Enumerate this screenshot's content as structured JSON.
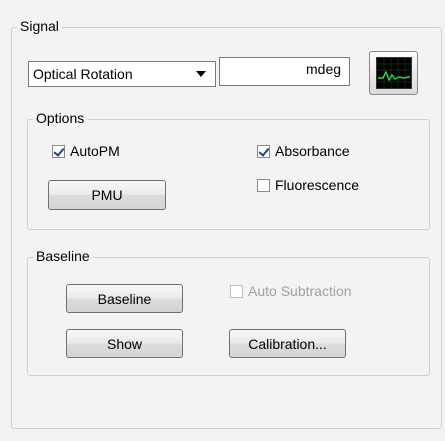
{
  "signal": {
    "group_label": "Signal",
    "mode_select": {
      "selected": "Optical Rotation"
    },
    "value_field": {
      "value": "",
      "unit": "mdeg"
    },
    "graph_button": {
      "icon": "waveform-monitor-icon",
      "screen_color": "#000000",
      "trace_color": "#2bd34f"
    }
  },
  "options": {
    "group_label": "Options",
    "autopm": {
      "label": "AutoPM",
      "checked": true
    },
    "pmu_button": "PMU",
    "absorbance": {
      "label": "Absorbance",
      "checked": true
    },
    "fluorescence": {
      "label": "Fluorescence",
      "checked": false
    }
  },
  "baseline": {
    "group_label": "Baseline",
    "baseline_button": "Baseline",
    "show_button": "Show",
    "auto_subtraction": {
      "label": "Auto Subtraction",
      "checked": false,
      "enabled": false
    },
    "calibration_button": "Calibration..."
  }
}
